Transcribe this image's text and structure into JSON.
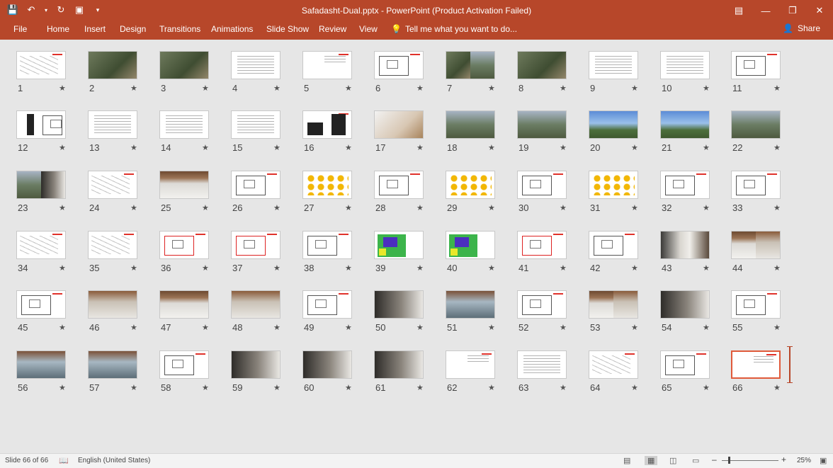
{
  "window": {
    "title": "Safadasht-Dual.pptx - PowerPoint (Product Activation Failed)",
    "qat_icons": [
      "save-icon",
      "undo-icon",
      "undo-dropdown-icon",
      "redo-icon",
      "present-icon",
      "customize-qat-icon"
    ],
    "controls": [
      "ribbon-display-icon",
      "minimize-icon",
      "restore-icon",
      "close-icon"
    ]
  },
  "ribbon": {
    "tabs": [
      "File",
      "Home",
      "Insert",
      "Design",
      "Transitions",
      "Animations",
      "Slide Show",
      "Review",
      "View"
    ],
    "tell_me": "Tell me what you want to do...",
    "share": "Share"
  },
  "slides": [
    {
      "n": "1",
      "t": "sketch",
      "sel": false
    },
    {
      "n": "2",
      "t": "green"
    },
    {
      "n": "3",
      "t": "green"
    },
    {
      "n": "4",
      "t": "text"
    },
    {
      "n": "5",
      "t": "text-small"
    },
    {
      "n": "6",
      "t": "plan"
    },
    {
      "n": "7",
      "t": "split-green"
    },
    {
      "n": "8",
      "t": "green"
    },
    {
      "n": "9",
      "t": "text"
    },
    {
      "n": "10",
      "t": "text"
    },
    {
      "n": "11",
      "t": "plan"
    },
    {
      "n": "12",
      "t": "blackwhite"
    },
    {
      "n": "13",
      "t": "text"
    },
    {
      "n": "14",
      "t": "text"
    },
    {
      "n": "15",
      "t": "text"
    },
    {
      "n": "16",
      "t": "blocks"
    },
    {
      "n": "17",
      "t": "model"
    },
    {
      "n": "18",
      "t": "outdoor"
    },
    {
      "n": "19",
      "t": "outdoor"
    },
    {
      "n": "20",
      "t": "sky"
    },
    {
      "n": "21",
      "t": "sky"
    },
    {
      "n": "22",
      "t": "outdoor"
    },
    {
      "n": "23",
      "t": "split-glass"
    },
    {
      "n": "24",
      "t": "sketch"
    },
    {
      "n": "25",
      "t": "wood"
    },
    {
      "n": "26",
      "t": "plan"
    },
    {
      "n": "27",
      "t": "dots"
    },
    {
      "n": "28",
      "t": "plan"
    },
    {
      "n": "29",
      "t": "dots"
    },
    {
      "n": "30",
      "t": "plan"
    },
    {
      "n": "31",
      "t": "dots"
    },
    {
      "n": "32",
      "t": "plan"
    },
    {
      "n": "33",
      "t": "plan"
    },
    {
      "n": "34",
      "t": "sketch"
    },
    {
      "n": "35",
      "t": "sketch"
    },
    {
      "n": "36",
      "t": "plan-red"
    },
    {
      "n": "37",
      "t": "plan-red"
    },
    {
      "n": "38",
      "t": "plan"
    },
    {
      "n": "39",
      "t": "colorplan"
    },
    {
      "n": "40",
      "t": "colorplan"
    },
    {
      "n": "41",
      "t": "plan-red"
    },
    {
      "n": "42",
      "t": "plan"
    },
    {
      "n": "43",
      "t": "corridor"
    },
    {
      "n": "44",
      "t": "split-wood"
    },
    {
      "n": "45",
      "t": "plan"
    },
    {
      "n": "46",
      "t": "interior"
    },
    {
      "n": "47",
      "t": "wood"
    },
    {
      "n": "48",
      "t": "interior"
    },
    {
      "n": "49",
      "t": "plan"
    },
    {
      "n": "50",
      "t": "dark"
    },
    {
      "n": "51",
      "t": "glass"
    },
    {
      "n": "52",
      "t": "plan"
    },
    {
      "n": "53",
      "t": "split-wood"
    },
    {
      "n": "54",
      "t": "dark"
    },
    {
      "n": "55",
      "t": "plan"
    },
    {
      "n": "56",
      "t": "glass"
    },
    {
      "n": "57",
      "t": "glass"
    },
    {
      "n": "58",
      "t": "plan"
    },
    {
      "n": "59",
      "t": "dark"
    },
    {
      "n": "60",
      "t": "dark"
    },
    {
      "n": "61",
      "t": "dark"
    },
    {
      "n": "62",
      "t": "text-small"
    },
    {
      "n": "63",
      "t": "text"
    },
    {
      "n": "64",
      "t": "sketch"
    },
    {
      "n": "65",
      "t": "plan"
    },
    {
      "n": "66",
      "t": "text-small",
      "sel": true
    }
  ],
  "status": {
    "slide_counter": "Slide 66 of 66",
    "language": "English (United States)",
    "zoom": "25%",
    "zoom_fraction": 0.25
  },
  "colors": {
    "accent": "#b7472a",
    "selection": "#e05a3a"
  }
}
